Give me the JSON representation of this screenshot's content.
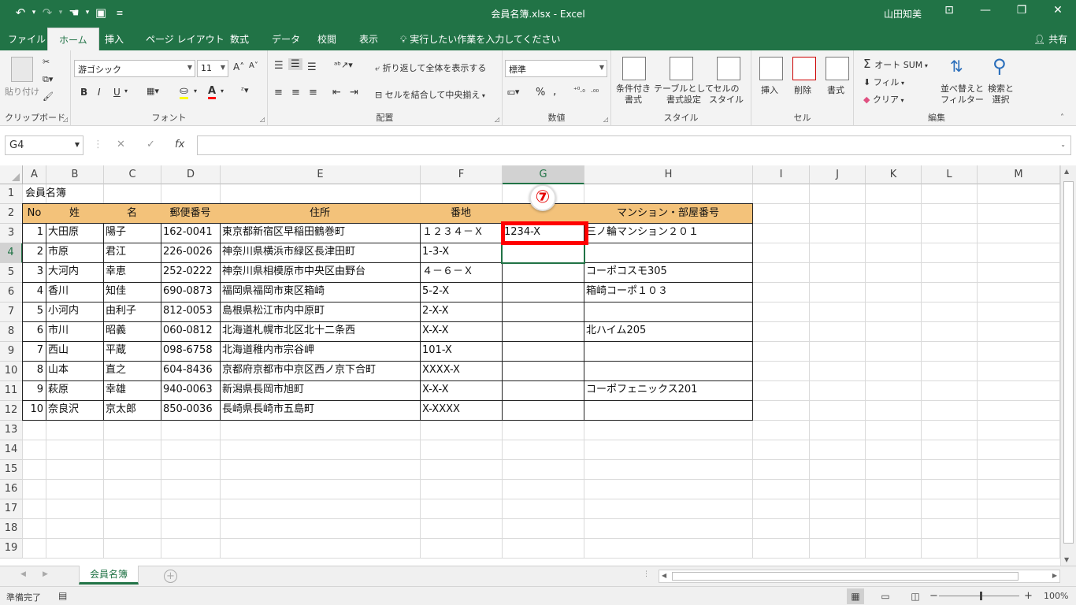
{
  "window": {
    "title": "会員名簿.xlsx  -  Excel",
    "user": "山田知美",
    "qat": {
      "undo": "↶",
      "redo": "↷",
      "touch": "☚",
      "save": "▣",
      "customize": "≡"
    },
    "controls": {
      "ribbon_display": "⊡",
      "minimize": "—",
      "restore": "❐",
      "close": "✕"
    }
  },
  "tabs": [
    "ファイル",
    "ホーム",
    "挿入",
    "ページ レイアウト",
    "数式",
    "データ",
    "校閲",
    "表示"
  ],
  "active_tab": "ホーム",
  "tell_me": "実行したい作業を入力してください",
  "share": "共有",
  "ribbon": {
    "clipboard": {
      "label": "クリップボード",
      "paste": "貼り付け"
    },
    "font": {
      "label": "フォント",
      "font_name": "游ゴシック",
      "font_size": "11",
      "bold": "B",
      "italic": "I",
      "underline": "U",
      "grow": "A˄",
      "shrink": "A˅"
    },
    "alignment": {
      "label": "配置",
      "wrap": "折り返して全体を表示する",
      "merge": "セルを結合して中央揃え"
    },
    "number": {
      "label": "数値",
      "format": "標準",
      "percent": "%",
      "comma": ","
    },
    "styles": {
      "label": "スタイル",
      "conditional": "条件付き\n書式",
      "table": "テーブルとして\n書式設定",
      "cell_styles": "セルの\nスタイル"
    },
    "cells": {
      "label": "セル",
      "insert": "挿入",
      "delete": "削除",
      "format": "書式"
    },
    "editing": {
      "label": "編集",
      "autosum": "オート SUM",
      "fill": "フィル",
      "clear": "クリア",
      "sort": "並べ替えと\nフィルター",
      "find": "検索と\n選択"
    }
  },
  "formula_bar": {
    "name_box": "G4",
    "cancel": "✕",
    "enter": "✓",
    "fx": "fx",
    "formula": ""
  },
  "grid": {
    "columns": [
      "A",
      "B",
      "C",
      "D",
      "E",
      "F",
      "G",
      "H",
      "I",
      "J",
      "K",
      "L",
      "M"
    ],
    "selected_column": "G",
    "row_numbers": [
      "1",
      "2",
      "3",
      "4",
      "5",
      "6",
      "7",
      "8",
      "9",
      "10",
      "11",
      "12",
      "13",
      "14",
      "15",
      "16",
      "17",
      "18",
      "19"
    ],
    "selected_row": "4",
    "a1": "会員名簿",
    "headers": [
      "No",
      "姓",
      "名",
      "郵便番号",
      "住所",
      "番地",
      "",
      "マンション・部屋番号"
    ],
    "rows": [
      [
        "1",
        "大田原",
        "陽子",
        "162-0041",
        "東京都新宿区早稲田鶴巻町",
        "１２３４－Ｘ",
        "1234-X",
        "三ノ輪マンション２０１"
      ],
      [
        "2",
        "市原",
        "君江",
        "226-0026",
        "神奈川県横浜市緑区長津田町",
        "1-3-X",
        "",
        ""
      ],
      [
        "3",
        "大河内",
        "幸恵",
        "252-0222",
        "神奈川県相模原市中央区由野台",
        "４－６－Ｘ",
        "",
        "コーポコスモ305"
      ],
      [
        "4",
        "香川",
        "知佳",
        "690-0873",
        "福岡県福岡市東区箱崎",
        "5-2-X",
        "",
        "箱崎コーポ１０３"
      ],
      [
        "5",
        "小河内",
        "由利子",
        "812-0053",
        "島根県松江市内中原町",
        "2-X-X",
        "",
        ""
      ],
      [
        "6",
        "市川",
        "昭義",
        "060-0812",
        "北海道札幌市北区北十二条西",
        "X-X-X",
        "",
        "北ハイム205"
      ],
      [
        "7",
        "西山",
        "平蔵",
        "098-6758",
        "北海道稚内市宗谷岬",
        "101-X",
        "",
        ""
      ],
      [
        "8",
        "山本",
        "直之",
        "604-8436",
        "京都府京都市中京区西ノ京下合町",
        "XXXX-X",
        "",
        ""
      ],
      [
        "9",
        "萩原",
        "幸雄",
        "940-0063",
        "新潟県長岡市旭町",
        "X-X-X",
        "",
        "コーポフェニックス201"
      ],
      [
        "10",
        "奈良沢",
        "京太郎",
        "850-0036",
        "長崎県長崎市五島町",
        "X-XXXX",
        "",
        ""
      ]
    ]
  },
  "annotation": {
    "step": "⑦"
  },
  "sheet_tabs": {
    "active": "会員名簿",
    "add": "+"
  },
  "status": {
    "ready": "準備完了",
    "zoom": "100%",
    "zoom_minus": "−",
    "zoom_plus": "+"
  },
  "colors": {
    "accent": "#217346",
    "header_fill": "#f3c27a",
    "highlight": "#ff0000"
  }
}
